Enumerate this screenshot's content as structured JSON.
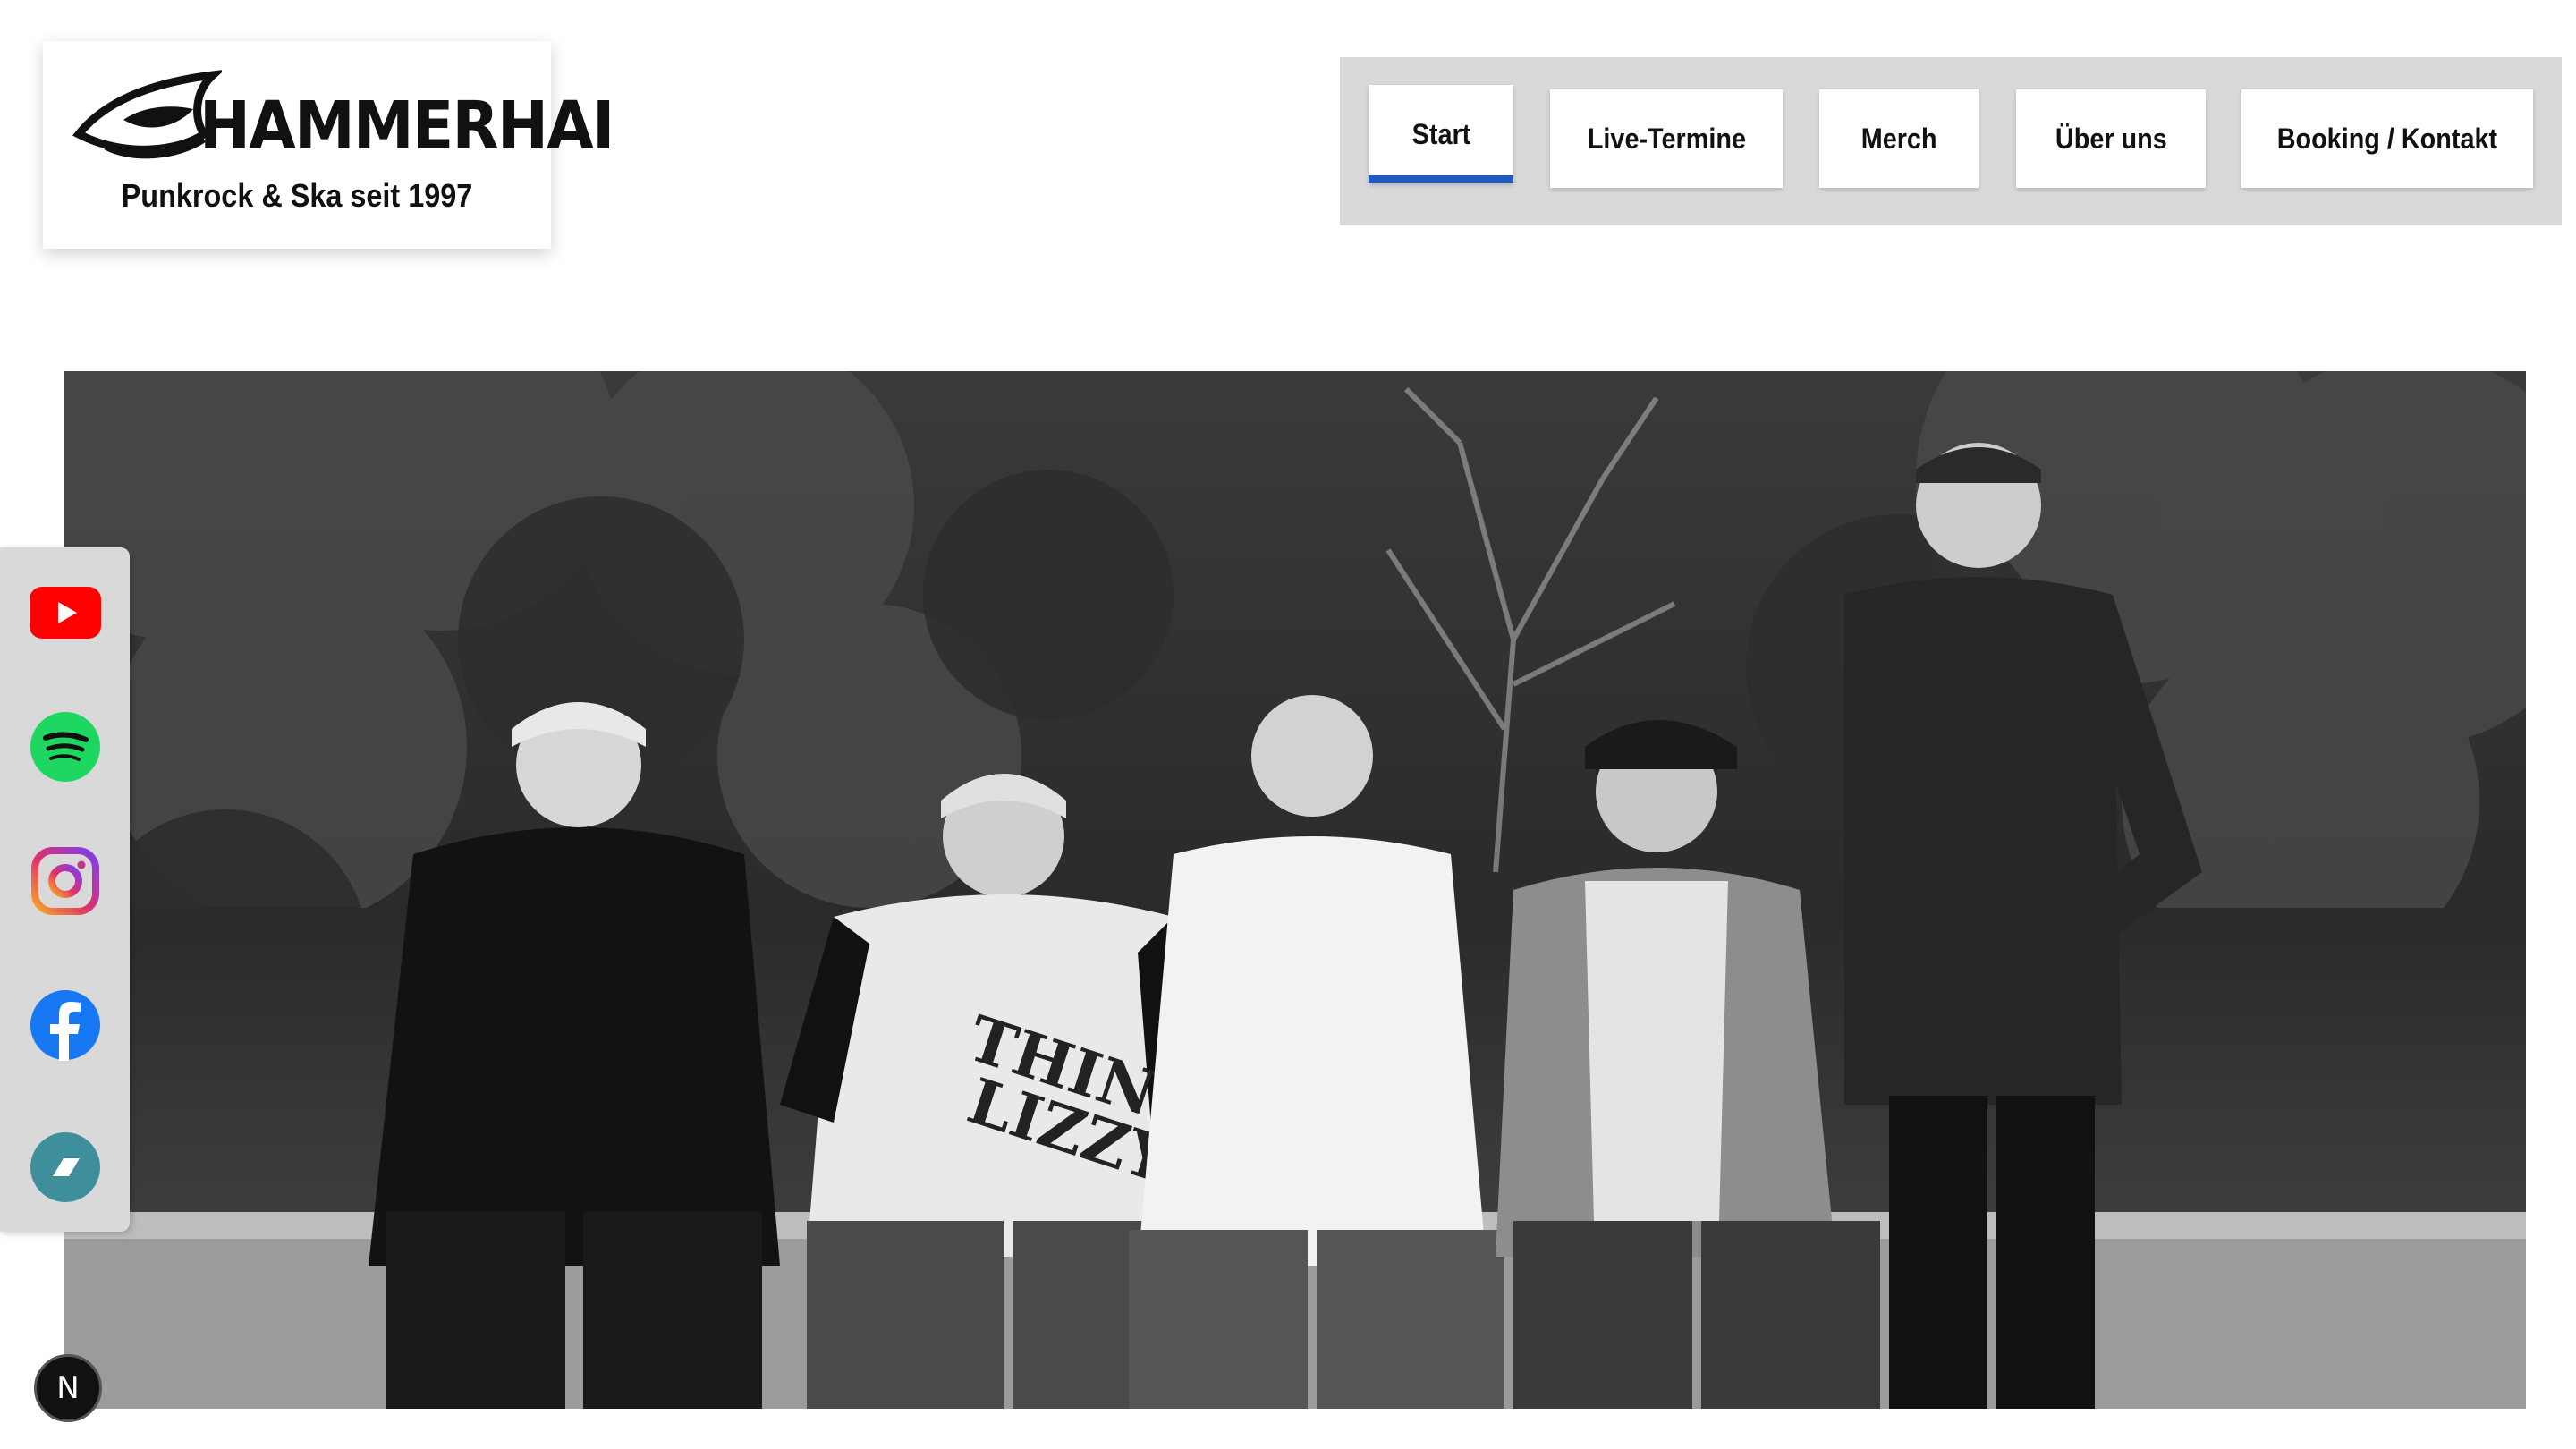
{
  "brand": {
    "name": "HAMMERHAI",
    "tagline": "Punkrock & Ska seit 1997"
  },
  "nav": {
    "items": [
      {
        "label": "Start",
        "active": true
      },
      {
        "label": "Live-Termine",
        "active": false
      },
      {
        "label": "Merch",
        "active": false
      },
      {
        "label": "Über uns",
        "active": false
      },
      {
        "label": "Booking / Kontakt",
        "active": false
      }
    ],
    "active_color": "#1f5bbd"
  },
  "social": [
    {
      "icon": "youtube-icon",
      "color": "#ff0000"
    },
    {
      "icon": "spotify-icon",
      "color": "#1ed760"
    },
    {
      "icon": "instagram-icon",
      "color": "#e1306c"
    },
    {
      "icon": "facebook-icon",
      "color": "#1877f2"
    },
    {
      "icon": "bandsintown-icon",
      "color": "#3e8e9b"
    }
  ],
  "hero": {
    "image": "band-photo-black-and-white"
  },
  "devtools": {
    "badge": "N"
  }
}
